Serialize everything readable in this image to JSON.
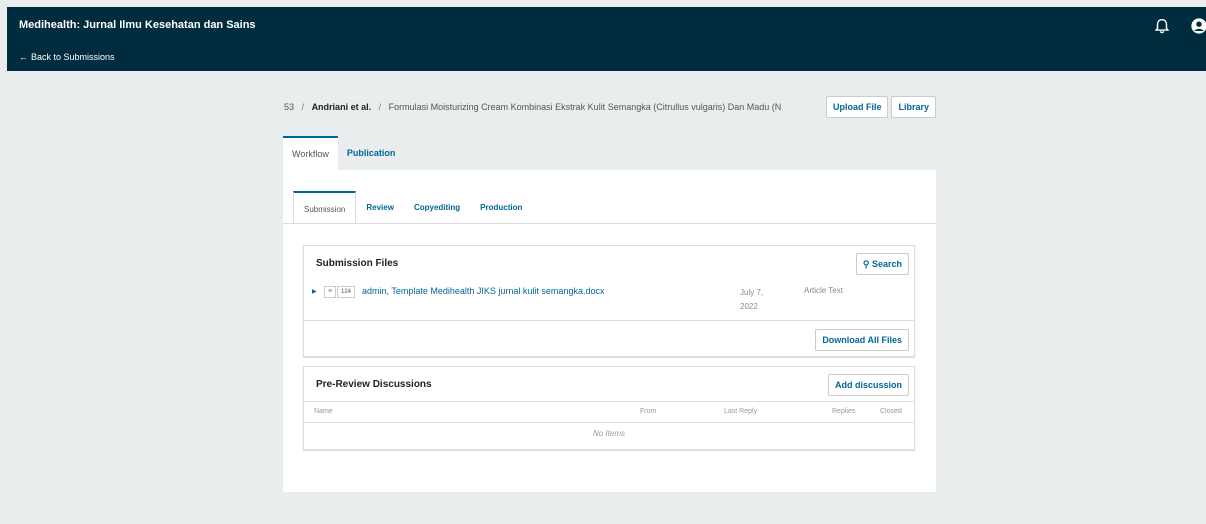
{
  "header": {
    "site_title": "Medihealth: Jurnal Ilmu Kesehatan dan Sains",
    "back_link": "Back to Submissions"
  },
  "breadcrumb": {
    "id": "53",
    "author": "Andriani et al.",
    "title": "Formulasi Moisturizing Cream Kombinasi Ekstrak Kulit Semangka (Citrullus vulgaris) Dan Madu (N"
  },
  "actions": {
    "upload_file": "Upload File",
    "library": "Library"
  },
  "outer_tabs": [
    "Workflow",
    "Publication"
  ],
  "inner_tabs": [
    "Submission",
    "Review",
    "Copyediting",
    "Production"
  ],
  "submission_files": {
    "title": "Submission Files",
    "search_label": "Search",
    "file": {
      "id": "124",
      "name": "admin, Template Medihealth JIKS jurnal kulit semangka.docx",
      "date": "July 7, 2022",
      "type": "Article Text"
    },
    "download_all": "Download All Files"
  },
  "discussions": {
    "title": "Pre-Review Discussions",
    "add_label": "Add discussion",
    "columns": [
      "Name",
      "From",
      "Last Reply",
      "Replies",
      "Closed"
    ],
    "empty": "No Items"
  },
  "colors": {
    "topbar": "#002c40",
    "link": "#006798",
    "background": "#eaedee"
  }
}
